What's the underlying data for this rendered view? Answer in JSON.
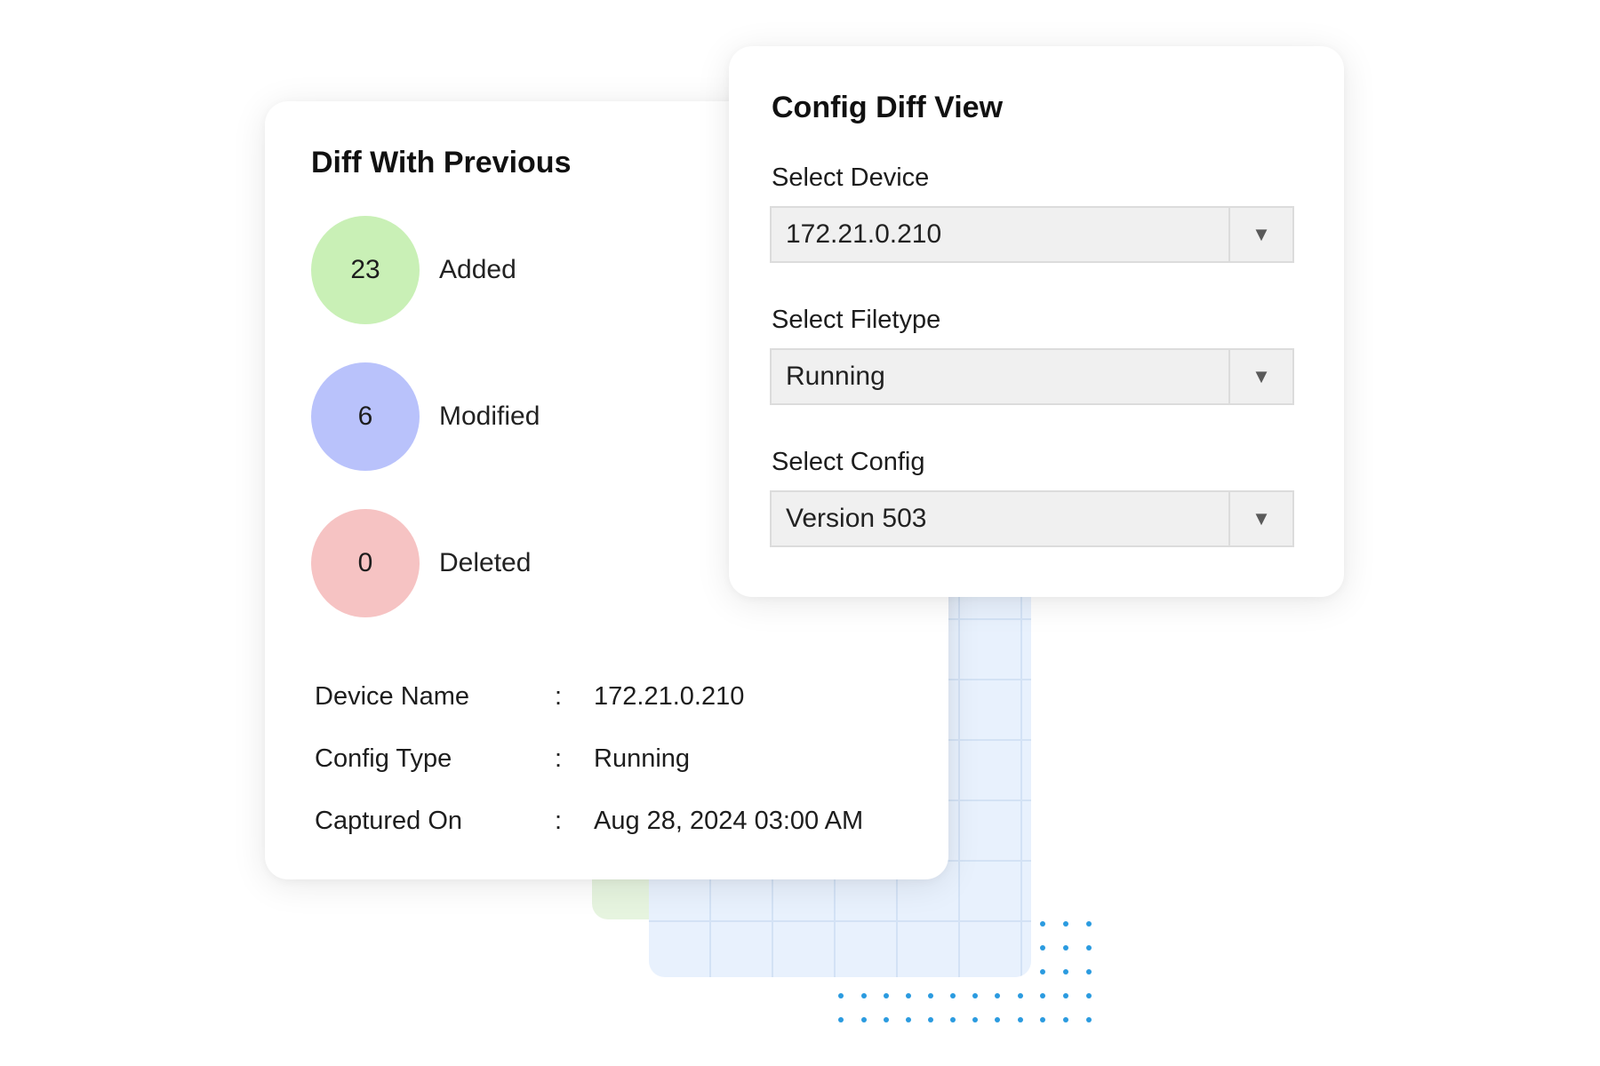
{
  "diff_panel": {
    "title": "Diff With Previous",
    "stats": [
      {
        "count": "23",
        "label": "Added",
        "color": "#c9f0b6"
      },
      {
        "count": "6",
        "label": "Modified",
        "color": "#b9c2fb"
      },
      {
        "count": "0",
        "label": "Deleted",
        "color": "#f6c3c3"
      }
    ],
    "details": [
      {
        "key": "Device Name",
        "sep": ":",
        "value": "172.21.0.210"
      },
      {
        "key": "Config Type",
        "sep": ":",
        "value": "Running"
      },
      {
        "key": "Captured On",
        "sep": ":",
        "value": "Aug 28, 2024 03:00 AM"
      }
    ]
  },
  "config_panel": {
    "title": "Config Diff View",
    "fields": [
      {
        "label": "Select Device",
        "value": "172.21.0.210",
        "icon": "triangle-down-icon"
      },
      {
        "label": "Select  Filetype",
        "value": "Running",
        "icon": "triangle-down-icon"
      },
      {
        "label": "Select  Config",
        "value": "Version 503",
        "icon": "triangle-down-icon"
      }
    ]
  },
  "decor": {
    "dot_color": "#2b9be0",
    "grid_color": "#e8f1fd",
    "green_tile_color": "#e6f4df"
  }
}
